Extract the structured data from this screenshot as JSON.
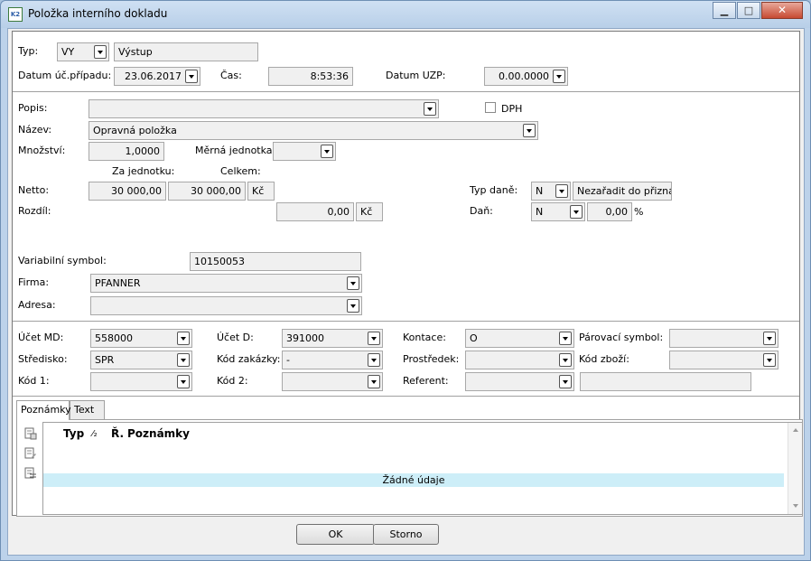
{
  "window": {
    "title": "Položka interního dokladu",
    "app_icon": "K2"
  },
  "header": {
    "typ_label": "Typ:",
    "typ_code": "VY",
    "typ_name": "Výstup",
    "datum_label": "Datum úč.případu:",
    "datum_value": "23.06.2017",
    "cas_label": "Čas:",
    "cas_value": "8:53:36",
    "uzp_label": "Datum UZP:",
    "uzp_value": "0.00.0000"
  },
  "item": {
    "popis_label": "Popis:",
    "popis_value": "",
    "dph_label": "DPH",
    "dph_checked": false,
    "nazev_label": "Název:",
    "nazev_value": "Opravná položka",
    "mnozstvi_label": "Množství:",
    "mnozstvi_value": "1,0000",
    "mj_label": "Měrná jednotka:",
    "mj_value": "",
    "za_jednotku_label": "Za jednotku:",
    "celkem_label": "Celkem:",
    "netto_label": "Netto:",
    "netto_unit": "30 000,00",
    "netto_total": "30 000,00",
    "netto_currency": "Kč",
    "rozdil_label": "Rozdíl:",
    "rozdil_value": "0,00",
    "rozdil_currency": "Kč",
    "typ_dane_label": "Typ daně:",
    "typ_dane_code": "N",
    "typ_dane_text": "Nezařadit do přiznání",
    "dan_label": "Daň:",
    "dan_code": "N",
    "dan_value": "0,00",
    "dan_percent": "%"
  },
  "partner": {
    "vs_label": "Variabilní symbol:",
    "vs_value": "10150053",
    "firma_label": "Firma:",
    "firma_value": "PFANNER",
    "adresa_label": "Adresa:",
    "adresa_value": ""
  },
  "accounting": {
    "ucet_md_label": "Účet MD:",
    "ucet_md_value": "558000",
    "ucet_d_label": "Účet D:",
    "ucet_d_value": "391000",
    "kontace_label": "Kontace:",
    "kontace_value": "O",
    "parovaci_label": "Párovací symbol:",
    "parovaci_value": "",
    "stredisko_label": "Středisko:",
    "stredisko_value": "SPR",
    "kod_zakazky_label": "Kód zakázky:",
    "kod_zakazky_value": "-",
    "prostredek_label": "Prostředek:",
    "prostredek_value": "",
    "kod_zbozi_label": "Kód zboží:",
    "kod_zbozi_value": "",
    "kod1_label": "Kód 1:",
    "kod1_value": "",
    "kod2_label": "Kód 2:",
    "kod2_value": "",
    "referent_label": "Referent:",
    "referent_value": "",
    "referent_name": ""
  },
  "tabs": [
    {
      "label": "Poznámky",
      "active": true
    },
    {
      "label": "Text",
      "active": false
    }
  ],
  "notes_grid": {
    "col_typ": "Typ",
    "col_sort": "⁄₂",
    "col_r": "Ř.",
    "col_poznamky": "Poznámky",
    "empty_text": "Žádné údaje"
  },
  "buttons": {
    "ok": "OK",
    "storno": "Storno"
  }
}
